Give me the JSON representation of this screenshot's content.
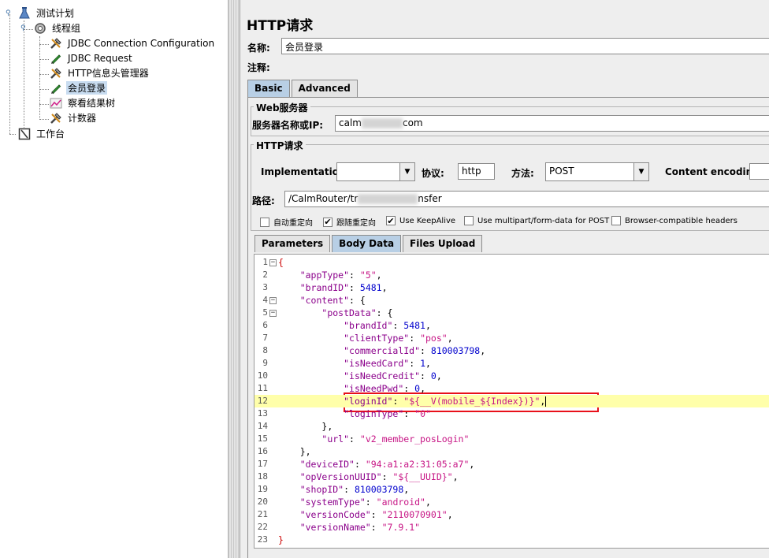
{
  "tree": {
    "items": [
      {
        "label": "测试计划",
        "icon": "test-plan-icon"
      },
      {
        "label": "线程组",
        "icon": "thread-group-icon"
      },
      {
        "label": "JDBC Connection Configuration",
        "icon": "config-wrench-icon"
      },
      {
        "label": "JDBC Request",
        "icon": "sampler-pen-icon"
      },
      {
        "label": "HTTP信息头管理器",
        "icon": "config-wrench-icon"
      },
      {
        "label": "会员登录",
        "icon": "sampler-pen-icon"
      },
      {
        "label": "察看结果树",
        "icon": "listener-chart-icon"
      },
      {
        "label": "计数器",
        "icon": "config-wrench-icon"
      },
      {
        "label": "工作台",
        "icon": "workbench-icon"
      }
    ]
  },
  "panel": {
    "title": "HTTP请求",
    "name_label": "名称:",
    "name_value": "会员登录",
    "comment_label": "注释:",
    "comment_value": "",
    "tabs": [
      {
        "label": "Basic"
      },
      {
        "label": "Advanced"
      }
    ],
    "web_server": {
      "section_title": "Web服务器",
      "host_label": "服务器名称或IP:",
      "host_prefix": "calm",
      "host_suffix": "com"
    },
    "http_request": {
      "section_title": "HTTP请求",
      "impl_label": "Implementation:",
      "impl_value": "",
      "protocol_label": "协议:",
      "protocol_value": "http",
      "method_label": "方法:",
      "method_value": "POST",
      "encoding_label": "Content encoding:",
      "encoding_value": "",
      "path_label": "路径:",
      "path_prefix": "/CalmRouter/tr",
      "path_suffix": "nsfer",
      "options": [
        {
          "label": "自动重定向",
          "checked": false
        },
        {
          "label": "跟随重定向",
          "checked": true
        },
        {
          "label": "Use KeepAlive",
          "checked": true
        },
        {
          "label": "Use multipart/form-data for POST",
          "checked": false
        },
        {
          "label": "Browser-compatible headers",
          "checked": false
        }
      ]
    },
    "sub_tabs": [
      {
        "label": "Parameters"
      },
      {
        "label": "Body Data"
      },
      {
        "label": "Files Upload"
      }
    ],
    "body_lines": [
      "{",
      "    \"appType\": \"5\",",
      "    \"brandID\": 5481,",
      "    \"content\": {",
      "        \"postData\": {",
      "            \"brandId\": 5481,",
      "            \"clientType\": \"pos\",",
      "            \"commercialId\": 810003798,",
      "            \"isNeedCard\": 1,",
      "            \"isNeedCredit\": 0,",
      "            \"isNeedPwd\": 0,",
      "            \"loginId\": \"${__V(mobile_${Index})}\",",
      "            \"loginType\": \"0\"",
      "        },",
      "        \"url\": \"v2_member_posLogin\"",
      "    },",
      "    \"deviceID\": \"94:a1:a2:31:05:a7\",",
      "    \"opVersionUUID\": \"${__UUID}\",",
      "    \"shopID\": 810003798,",
      "    \"systemType\": \"android\",",
      "    \"versionCode\": \"2110070901\",",
      "    \"versionName\": \"7.9.1\"",
      "}"
    ],
    "line_numbers": [
      "1",
      "2",
      "3",
      "4",
      "5",
      "6",
      "7",
      "8",
      "9",
      "10",
      "11",
      "12",
      "13",
      "14",
      "15",
      "16",
      "17",
      "18",
      "19",
      "20",
      "21",
      "22",
      "23"
    ]
  },
  "colors": {
    "highlight_line": "#ffffaa",
    "annotation_box": "#e8101a",
    "active_tab": "#b8cfe5"
  }
}
